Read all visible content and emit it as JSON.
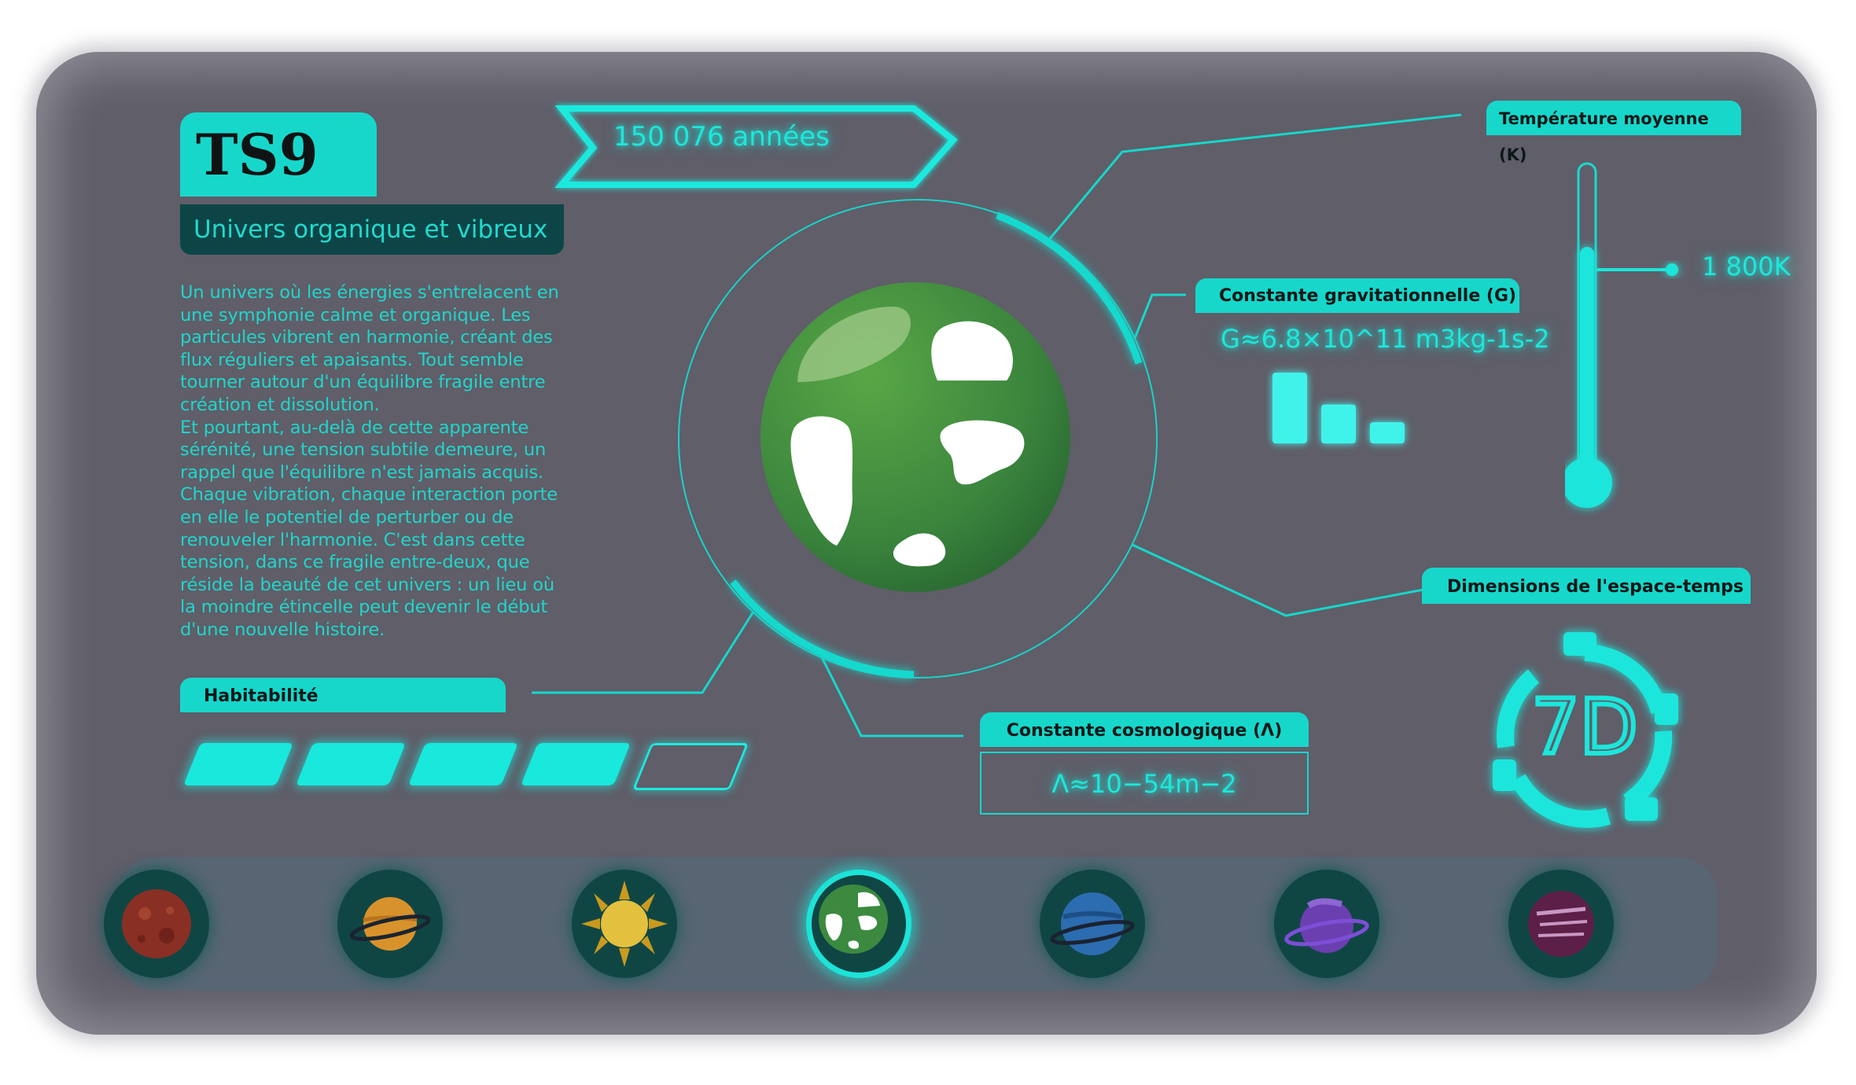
{
  "universe": {
    "code": "TS9",
    "subtitle": "Univers organique et vibreux",
    "description": "Un univers où les énergies s'entrelacent en\nune symphonie calme et organique. Les\nparticules vibrent en harmonie, créant des\nflux réguliers et apaisants. Tout semble\ntourner autour d'un équilibre fragile entre\ncréation et dissolution.\nEt pourtant, au-delà de cette apparente\nsérénité, une tension subtile demeure, un\nrappel que l'équilibre n'est jamais acquis.\nChaque vibration, chaque interaction porte\nen elle le potentiel de perturber ou de\nrenouveler l'harmonie. C'est dans cette\ntension, dans ce fragile entre-deux, que\nréside la beauté de cet univers : un lieu où\nla moindre étincelle peut devenir le début\nd'une nouvelle histoire.",
    "age": "150 076 années"
  },
  "habitability": {
    "label": "Habitabilité",
    "filled": 4,
    "total": 5
  },
  "temperature": {
    "label": "Température moyenne (K)",
    "value": "1 800K",
    "level": 0.74
  },
  "gravitation": {
    "label": "Constante gravitationnelle (G)",
    "value": "G≈6.8×10^11 m3kg-1s-2",
    "bars": [
      1.0,
      0.55,
      0.3
    ]
  },
  "cosmological": {
    "label": "Constante cosmologique (Λ)",
    "value": "Λ≈10−54m−2"
  },
  "spacetime": {
    "label": "Dimensions de l'espace-temps",
    "value": "7D"
  },
  "planets": [
    {
      "name": "red-planet-icon",
      "active": false
    },
    {
      "name": "ringed-orange-planet-icon",
      "active": false
    },
    {
      "name": "sun-icon",
      "active": false
    },
    {
      "name": "green-planet-icon",
      "active": true
    },
    {
      "name": "blue-ringed-planet-icon",
      "active": false
    },
    {
      "name": "purple-ringed-planet-icon",
      "active": false
    },
    {
      "name": "striped-purple-planet-icon",
      "active": false
    }
  ],
  "colors": {
    "accent": "#17d7cb",
    "panel": "#5f5e69",
    "planet_green": "#3b8a3f"
  }
}
